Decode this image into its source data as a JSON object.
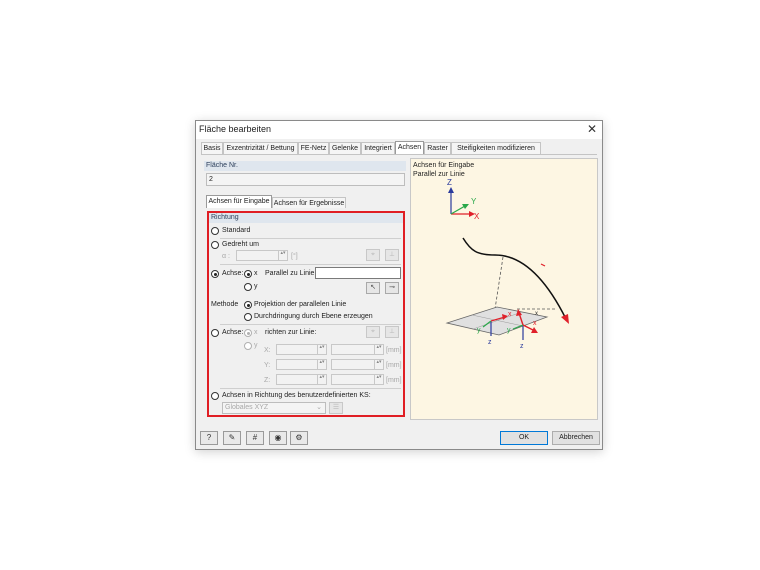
{
  "window": {
    "title": "Fläche bearbeiten",
    "close_glyph": "✕"
  },
  "tabs": [
    "Basis",
    "Exzentrizität / Bettung",
    "FE-Netz",
    "Gelenke",
    "Integriert",
    "Achsen",
    "Raster",
    "Steifigkeiten modifizieren"
  ],
  "active_tab": "Achsen",
  "flaeche": {
    "label": "Fläche Nr.",
    "value": "2"
  },
  "subtabs": [
    "Achsen für Eingabe",
    "Achsen für Ergebnisse"
  ],
  "richtung": {
    "header": "Richtung",
    "standard": "Standard",
    "gedreht_um": "Gedreht um",
    "alpha_label": "α :",
    "alpha_unit": "[°]",
    "achse_label": "Achse:",
    "x": "x",
    "y": "y",
    "parallel_label": "Parallel zu Linie:",
    "parallel_value": "",
    "methode_label": "Methode",
    "methode_projektion": "Projektion der parallelen Linie",
    "methode_durchdringung": "Durchdringung durch Ebene erzeugen",
    "achse2_label": "Achse:",
    "richten_label": "richten zur Linie:",
    "coord_labels": [
      "X:",
      "Y:",
      "Z:"
    ],
    "unit_mm": "[mm]",
    "benutzer_label": "Achsen in Richtung des benutzerdefinierten KS:",
    "ks_value": "Globales XYZ"
  },
  "preview": {
    "caption_line1": "Achsen für Eingabe",
    "caption_line2": "Parallel zur Linie",
    "axis_labels": {
      "Z": "Z",
      "Y": "Y",
      "X": "X",
      "x": "x",
      "y": "y",
      "z": "z",
      "xmin": "x"
    },
    "colors": {
      "x": "#e0202a",
      "y": "#2aa84a",
      "z": "#2a3a9c"
    }
  },
  "buttons": {
    "ok": "OK",
    "cancel": "Abbrechen"
  },
  "icons": [
    "help-icon",
    "edit-icon",
    "numbers-icon",
    "view-icon",
    "settings-icon"
  ],
  "colors": {
    "highlight": "#e01e24",
    "header_bg": "#dfe6ee",
    "preview_bg": "#fdf6e3"
  }
}
